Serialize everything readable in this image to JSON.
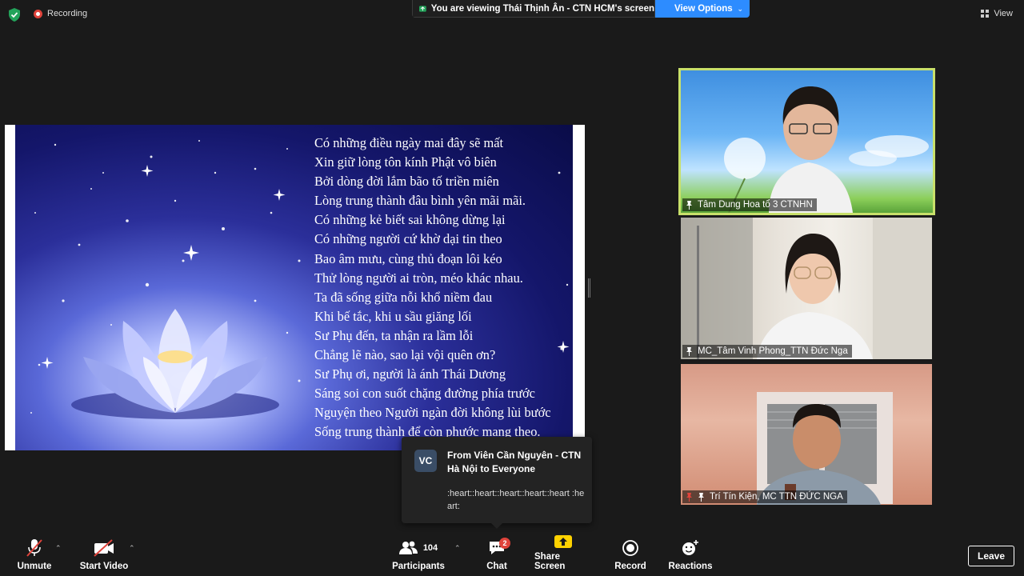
{
  "top": {
    "recording_label": "Recording",
    "viewing_text": "You are viewing Thái Thịnh Ân - CTN HCM's screen",
    "view_options_label": "View Options",
    "view_label": "View"
  },
  "slide": {
    "poem_lines": [
      "Có những điều ngày mai đây sẽ mất",
      "Xin giữ lòng tôn kính Phật vô biên",
      "Bởi dòng đời lắm bão tố triền miên",
      "Lòng trung thành đâu bình yên mãi mãi.",
      "Có những kẻ biết sai không dừng lại",
      "Có những người cứ khờ dại tin theo",
      "Bao âm mưu, cùng thủ đoạn lôi kéo",
      "Thử lòng người ai tròn, méo khác nhau.",
      "Ta đã sống giữa nỗi khổ niềm đau",
      "Khi bế tắc, khi u sầu giăng lối",
      "Sư Phụ đến, ta nhận ra lầm lỗi",
      "Chẳng lẽ nào, sao lại vội quên ơn?",
      "Sư Phụ ơi, người là ánh Thái Dương",
      "Sáng soi con suốt chặng đường phía trước",
      "Nguyện theo Người ngàn đời không lùi bước",
      "Sống trung thành để còn phước mang theo."
    ]
  },
  "participants": [
    {
      "name": "Tâm Dung Hoa tổ 3 CTNHN"
    },
    {
      "name": "MC_Tâm Vinh Phong_TTN Đức Nga"
    },
    {
      "name": "Trí Tín Kiện, MC  TTN ĐỨC NGA"
    }
  ],
  "chat_popup": {
    "initials": "VC",
    "from": "From Viên Cần Nguyên - CTN Hà Nội to Everyone",
    "message": ":heart::heart::heart::heart::heart :heart:"
  },
  "toolbar": {
    "unmute": "Unmute",
    "start_video": "Start Video",
    "participants_count": "104",
    "participants": "Participants",
    "chat": "Chat",
    "chat_badge": "2",
    "share_screen": "Share Screen",
    "record": "Record",
    "reactions": "Reactions",
    "leave": "Leave"
  },
  "colors": {
    "accent_blue": "#2d8cff",
    "recording_red": "#e0433b",
    "active_speaker_border": "#c8e06a",
    "share_green": "#ffd200"
  }
}
